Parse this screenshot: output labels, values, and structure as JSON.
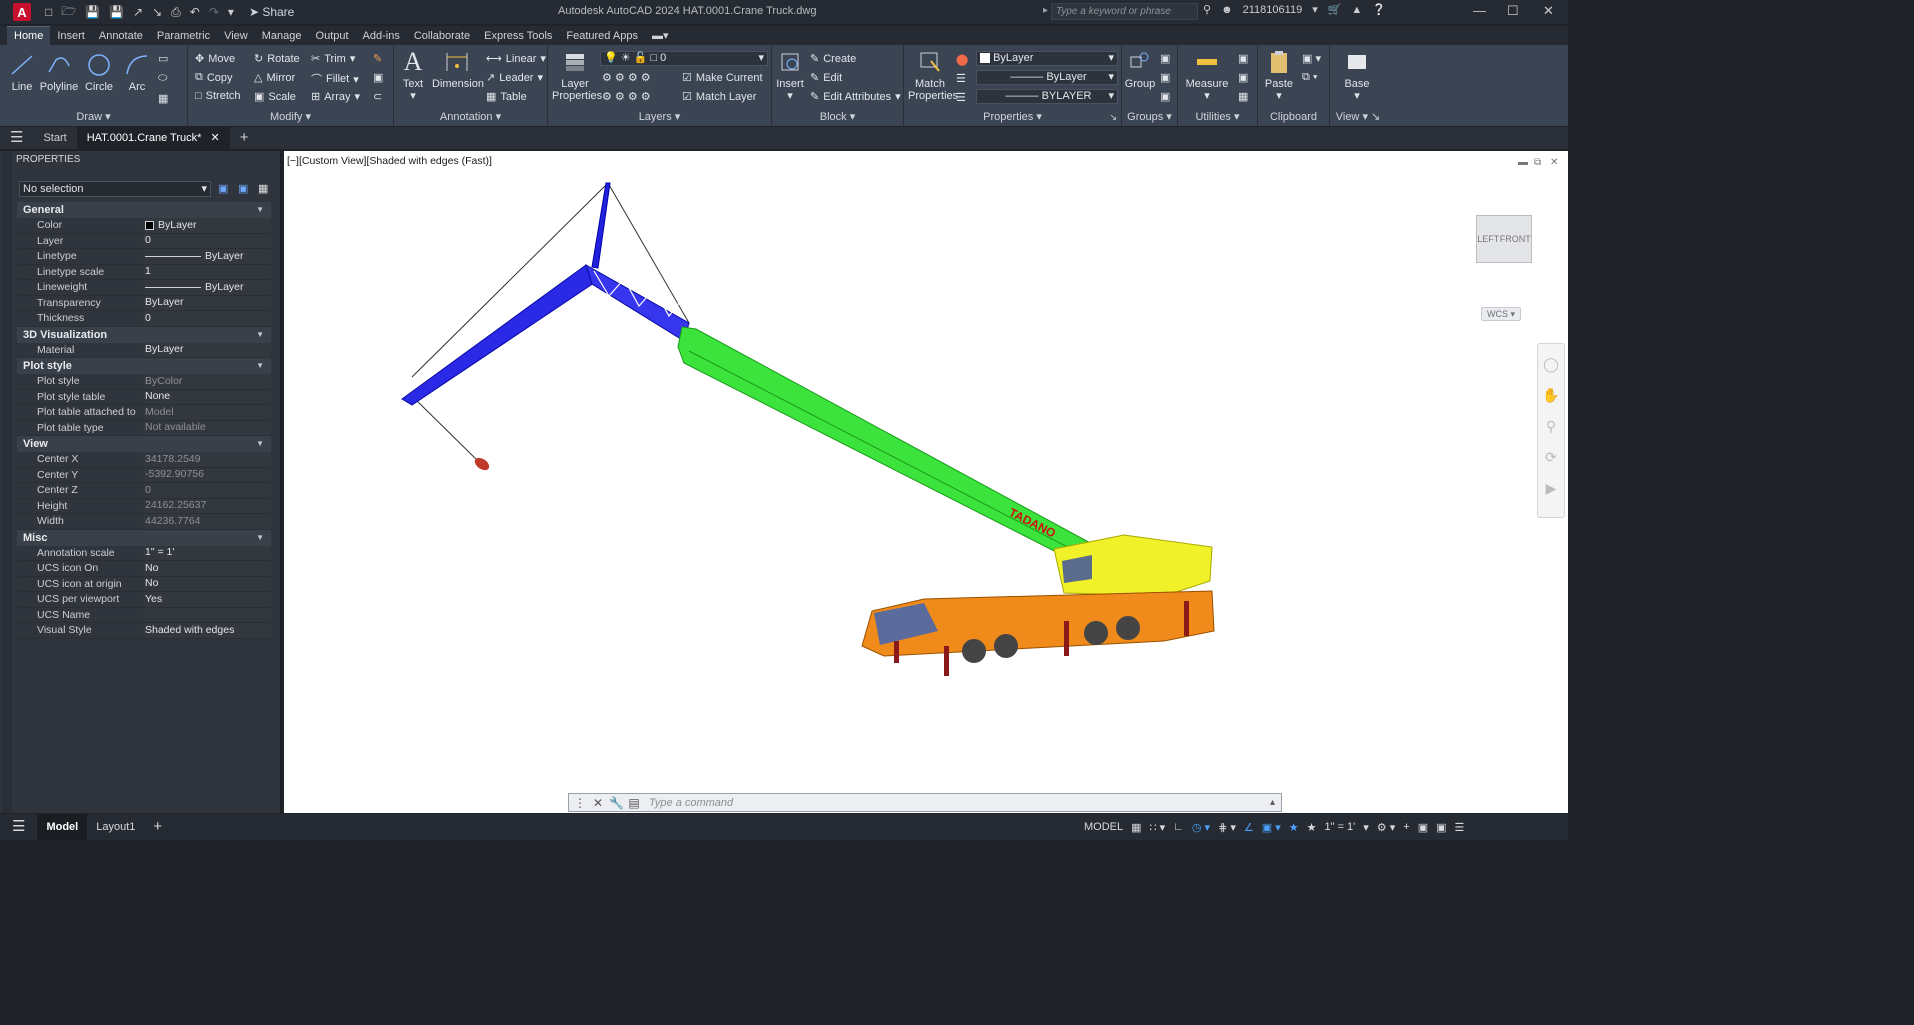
{
  "titlebar": {
    "app_letter": "A",
    "share_label": "Share",
    "title": "Autodesk AutoCAD 2024    HAT.0001.Crane Truck.dwg",
    "search_placeholder": "Type a keyword or phrase",
    "user_id": "2118106119"
  },
  "ribbon_tabs": [
    "Home",
    "Insert",
    "Annotate",
    "Parametric",
    "View",
    "Manage",
    "Output",
    "Add-ins",
    "Collaborate",
    "Express Tools",
    "Featured Apps"
  ],
  "ribbon": {
    "draw": {
      "title": "Draw",
      "line": "Line",
      "polyline": "Polyline",
      "circle": "Circle",
      "arc": "Arc"
    },
    "modify": {
      "title": "Modify",
      "move": "Move",
      "rotate": "Rotate",
      "trim": "Trim",
      "copy": "Copy",
      "mirror": "Mirror",
      "fillet": "Fillet",
      "stretch": "Stretch",
      "scale": "Scale",
      "array": "Array"
    },
    "annotation": {
      "title": "Annotation",
      "text": "Text",
      "dimension": "Dimension",
      "linear": "Linear",
      "leader": "Leader",
      "table": "Table"
    },
    "layers": {
      "title": "Layers",
      "layer_properties": "Layer Properties",
      "current_layer": "0",
      "make_current": "Make Current",
      "match_layer": "Match Layer"
    },
    "block": {
      "title": "Block",
      "insert": "Insert",
      "create": "Create",
      "edit": "Edit",
      "edit_attributes": "Edit Attributes"
    },
    "properties": {
      "title": "Properties",
      "match_properties": "Match Properties",
      "color": "ByLayer",
      "linetype": "ByLayer",
      "lineweight": "BYLAYER"
    },
    "groups": {
      "title": "Groups",
      "group": "Group"
    },
    "utilities": {
      "title": "Utilities",
      "measure": "Measure"
    },
    "clipboard": {
      "title": "Clipboard",
      "paste": "Paste"
    },
    "view": {
      "title": "View",
      "base": "Base"
    }
  },
  "doc_tabs": {
    "start": "Start",
    "active": "HAT.0001.Crane Truck*"
  },
  "properties_palette": {
    "title": "PROPERTIES",
    "selection": "No selection",
    "categories": [
      {
        "name": "General",
        "rows": [
          {
            "key": "Color",
            "value": "ByLayer",
            "type": "swatch"
          },
          {
            "key": "Layer",
            "value": "0"
          },
          {
            "key": "Linetype",
            "value": "ByLayer",
            "type": "line"
          },
          {
            "key": "Linetype scale",
            "value": "1"
          },
          {
            "key": "Lineweight",
            "value": "ByLayer",
            "type": "line"
          },
          {
            "key": "Transparency",
            "value": "ByLayer"
          },
          {
            "key": "Thickness",
            "value": "0"
          }
        ]
      },
      {
        "name": "3D Visualization",
        "rows": [
          {
            "key": "Material",
            "value": "ByLayer"
          }
        ]
      },
      {
        "name": "Plot style",
        "rows": [
          {
            "key": "Plot style",
            "value": "ByColor",
            "dim": true
          },
          {
            "key": "Plot style table",
            "value": "None"
          },
          {
            "key": "Plot table attached to",
            "value": "Model",
            "dim": true
          },
          {
            "key": "Plot table type",
            "value": "Not available",
            "dim": true
          }
        ]
      },
      {
        "name": "View",
        "rows": [
          {
            "key": "Center X",
            "value": "34178.2549",
            "dim": true
          },
          {
            "key": "Center Y",
            "value": "-5392.90756",
            "dim": true
          },
          {
            "key": "Center Z",
            "value": "0",
            "dim": true
          },
          {
            "key": "Height",
            "value": "24162.25637",
            "dim": true
          },
          {
            "key": "Width",
            "value": "44236.7764",
            "dim": true
          }
        ]
      },
      {
        "name": "Misc",
        "rows": [
          {
            "key": "Annotation scale",
            "value": "1\" = 1'"
          },
          {
            "key": "UCS icon On",
            "value": "No"
          },
          {
            "key": "UCS icon at origin",
            "value": "No"
          },
          {
            "key": "UCS per viewport",
            "value": "Yes"
          },
          {
            "key": "UCS Name",
            "value": ""
          },
          {
            "key": "Visual Style",
            "value": "Shaded with edges"
          }
        ]
      }
    ]
  },
  "viewport": {
    "label": "[−][Custom View][Shaded with edges (Fast)]",
    "viewcube_left": "LEFT",
    "viewcube_front": "FRONT",
    "wcs": "WCS",
    "brand_text": "TADANO"
  },
  "command_line": {
    "placeholder": "Type  a  command"
  },
  "status_bar": {
    "model": "Model",
    "layout1": "Layout1",
    "model_space": "MODEL",
    "scale": "1\" = 1'"
  }
}
